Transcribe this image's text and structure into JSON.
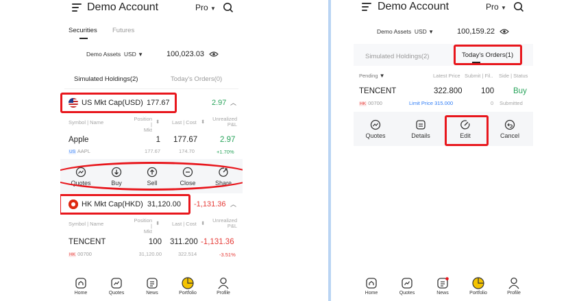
{
  "left": {
    "header": {
      "title": "Demo Account",
      "mode": "Pro"
    },
    "tabs": [
      "Securities",
      "Futures"
    ],
    "assets": {
      "label": "Demo Assets",
      "currency": "USD",
      "value": "100,023.03"
    },
    "subtabs": [
      "Simulated Holdings(2)",
      "Today's Orders(0)"
    ],
    "us_group": {
      "label": "US Mkt Cap(USD)",
      "value": "177.67",
      "pl": "2.97"
    },
    "columns": {
      "symbol": "Symbol | Name",
      "position": "Position |",
      "position2": "Mkt",
      "last": "Last | Cost",
      "pl": "Unrealized",
      "pl2": "P&L"
    },
    "apple": {
      "name": "Apple",
      "market": "US",
      "ticker": "AAPL",
      "qty": "1",
      "mkt": "177.67",
      "last": "177.67",
      "cost": "174.70",
      "pl": "2.97",
      "pl_pct": "+1.70%"
    },
    "actions": [
      "Quotes",
      "Buy",
      "Sell",
      "Close",
      "Share"
    ],
    "hk_group": {
      "label": "HK Mkt Cap(HKD)",
      "value": "31,120.00",
      "pl": "-1,131.36"
    },
    "tencent": {
      "name": "TENCENT",
      "market": "HK",
      "ticker": "00700",
      "qty": "100",
      "mkt": "31,120.00",
      "last": "311.200",
      "cost": "322.514",
      "pl": "-1,131.36",
      "pl_pct": "-3.51%"
    },
    "nav": [
      "Home",
      "Quotes",
      "News",
      "Portfolio",
      "Profile"
    ]
  },
  "right": {
    "header": {
      "title": "Demo Account",
      "mode": "Pro"
    },
    "assets": {
      "label": "Demo Assets",
      "currency": "USD",
      "value": "100,159.22"
    },
    "subtabs": [
      "Simulated Holdings(2)",
      "Today's Orders(1)"
    ],
    "filter": "Pending",
    "columns": {
      "latest": "Latest Price",
      "submit": "Submit | Fil..",
      "side": "Side | Status"
    },
    "order": {
      "name": "TENCENT",
      "market": "HK",
      "ticker": "00700",
      "price": "322.800",
      "qty": "100",
      "side": "Buy",
      "limit": "Limit Price 315.000",
      "filled": "0",
      "status": "Submitted"
    },
    "actions": [
      "Quotes",
      "Details",
      "Edit",
      "Cancel"
    ],
    "nav": [
      "Home",
      "Quotes",
      "News",
      "Portfolio",
      "Profile"
    ]
  },
  "colors": {
    "accent_red": "#e8161c",
    "gain": "#27a35a",
    "loss": "#e53935",
    "portfolio": "#f5c400",
    "divider": "#b9d4f3"
  }
}
